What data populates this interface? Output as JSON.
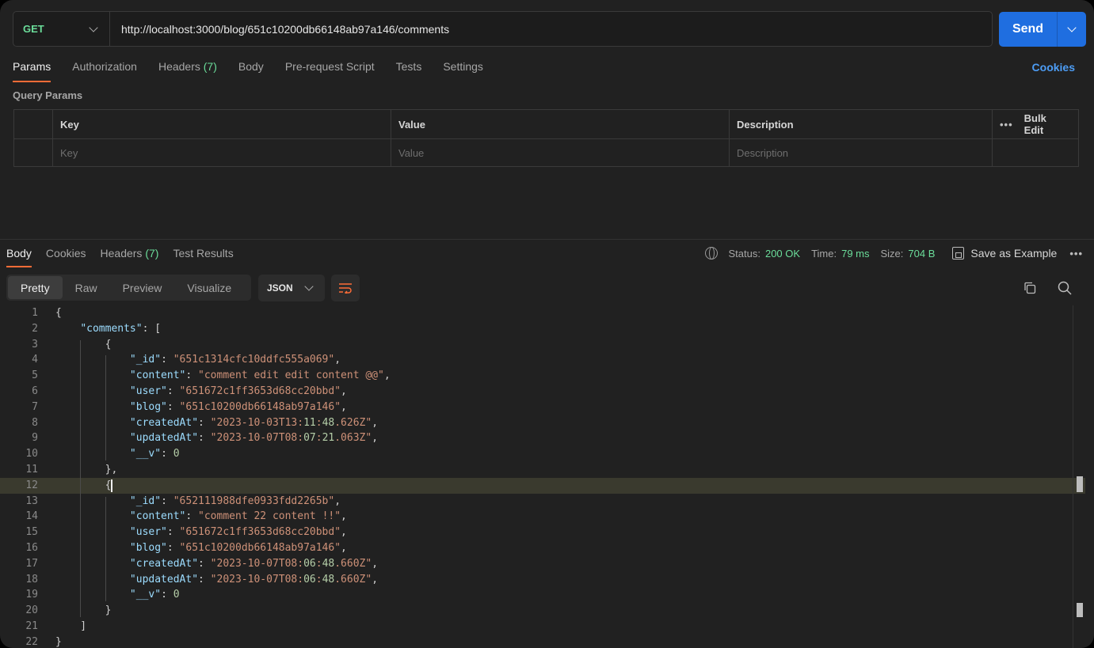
{
  "request": {
    "method": "GET",
    "url": "http://localhost:3000/blog/651c10200db66148ab97a146/comments",
    "send_label": "Send"
  },
  "req_tabs": [
    {
      "label": "Params",
      "count": ""
    },
    {
      "label": "Authorization",
      "count": ""
    },
    {
      "label": "Headers",
      "count": "(7)"
    },
    {
      "label": "Body",
      "count": ""
    },
    {
      "label": "Pre-request Script",
      "count": ""
    },
    {
      "label": "Tests",
      "count": ""
    },
    {
      "label": "Settings",
      "count": ""
    }
  ],
  "cookies_label": "Cookies",
  "query_params": {
    "title": "Query Params",
    "headers": [
      "Key",
      "Value",
      "Description"
    ],
    "bulk_edit": "Bulk Edit",
    "placeholders": [
      "Key",
      "Value",
      "Description"
    ]
  },
  "response": {
    "tabs": [
      {
        "label": "Body",
        "count": ""
      },
      {
        "label": "Cookies",
        "count": ""
      },
      {
        "label": "Headers",
        "count": "(7)"
      },
      {
        "label": "Test Results",
        "count": ""
      }
    ],
    "status_label": "Status:",
    "status": "200 OK",
    "time_label": "Time:",
    "time": "79 ms",
    "size_label": "Size:",
    "size": "704 B",
    "save_example": "Save as Example",
    "view_modes": [
      "Pretty",
      "Raw",
      "Preview",
      "Visualize"
    ],
    "format": "JSON"
  },
  "code_lines": [
    "{",
    "    \"comments\": [",
    "        {",
    "            \"_id\": \"651c1314cfc10ddfc555a069\",",
    "            \"content\": \"comment edit edit content @@\",",
    "            \"user\": \"651672c1ff3653d68cc20bbd\",",
    "            \"blog\": \"651c10200db66148ab97a146\",",
    "            \"createdAt\": \"2023-10-03T13:11:48.626Z\",",
    "            \"updatedAt\": \"2023-10-07T08:07:21.063Z\",",
    "            \"__v\": 0",
    "        },",
    "        {",
    "            \"_id\": \"652111988dfe0933fdd2265b\",",
    "            \"content\": \"comment 22 content !!\",",
    "            \"user\": \"651672c1ff3653d68cc20bbd\",",
    "            \"blog\": \"651c10200db66148ab97a146\",",
    "            \"createdAt\": \"2023-10-07T08:06:48.660Z\",",
    "            \"updatedAt\": \"2023-10-07T08:06:48.660Z\",",
    "            \"__v\": 0",
    "        }",
    "    ]",
    "}"
  ],
  "highlighted_line": 12,
  "colors": {
    "accent": "#ff6c37",
    "send": "#1f6ee0",
    "method": "#6bdd9a",
    "link": "#4d9df5",
    "json_key": "#9cdcfe",
    "json_string": "#ce9178",
    "json_number": "#b5cea8"
  },
  "icons": [
    "chevron-down-icon",
    "globe-icon",
    "save-icon",
    "more-icon",
    "wrap-icon",
    "copy-icon",
    "search-icon"
  ]
}
